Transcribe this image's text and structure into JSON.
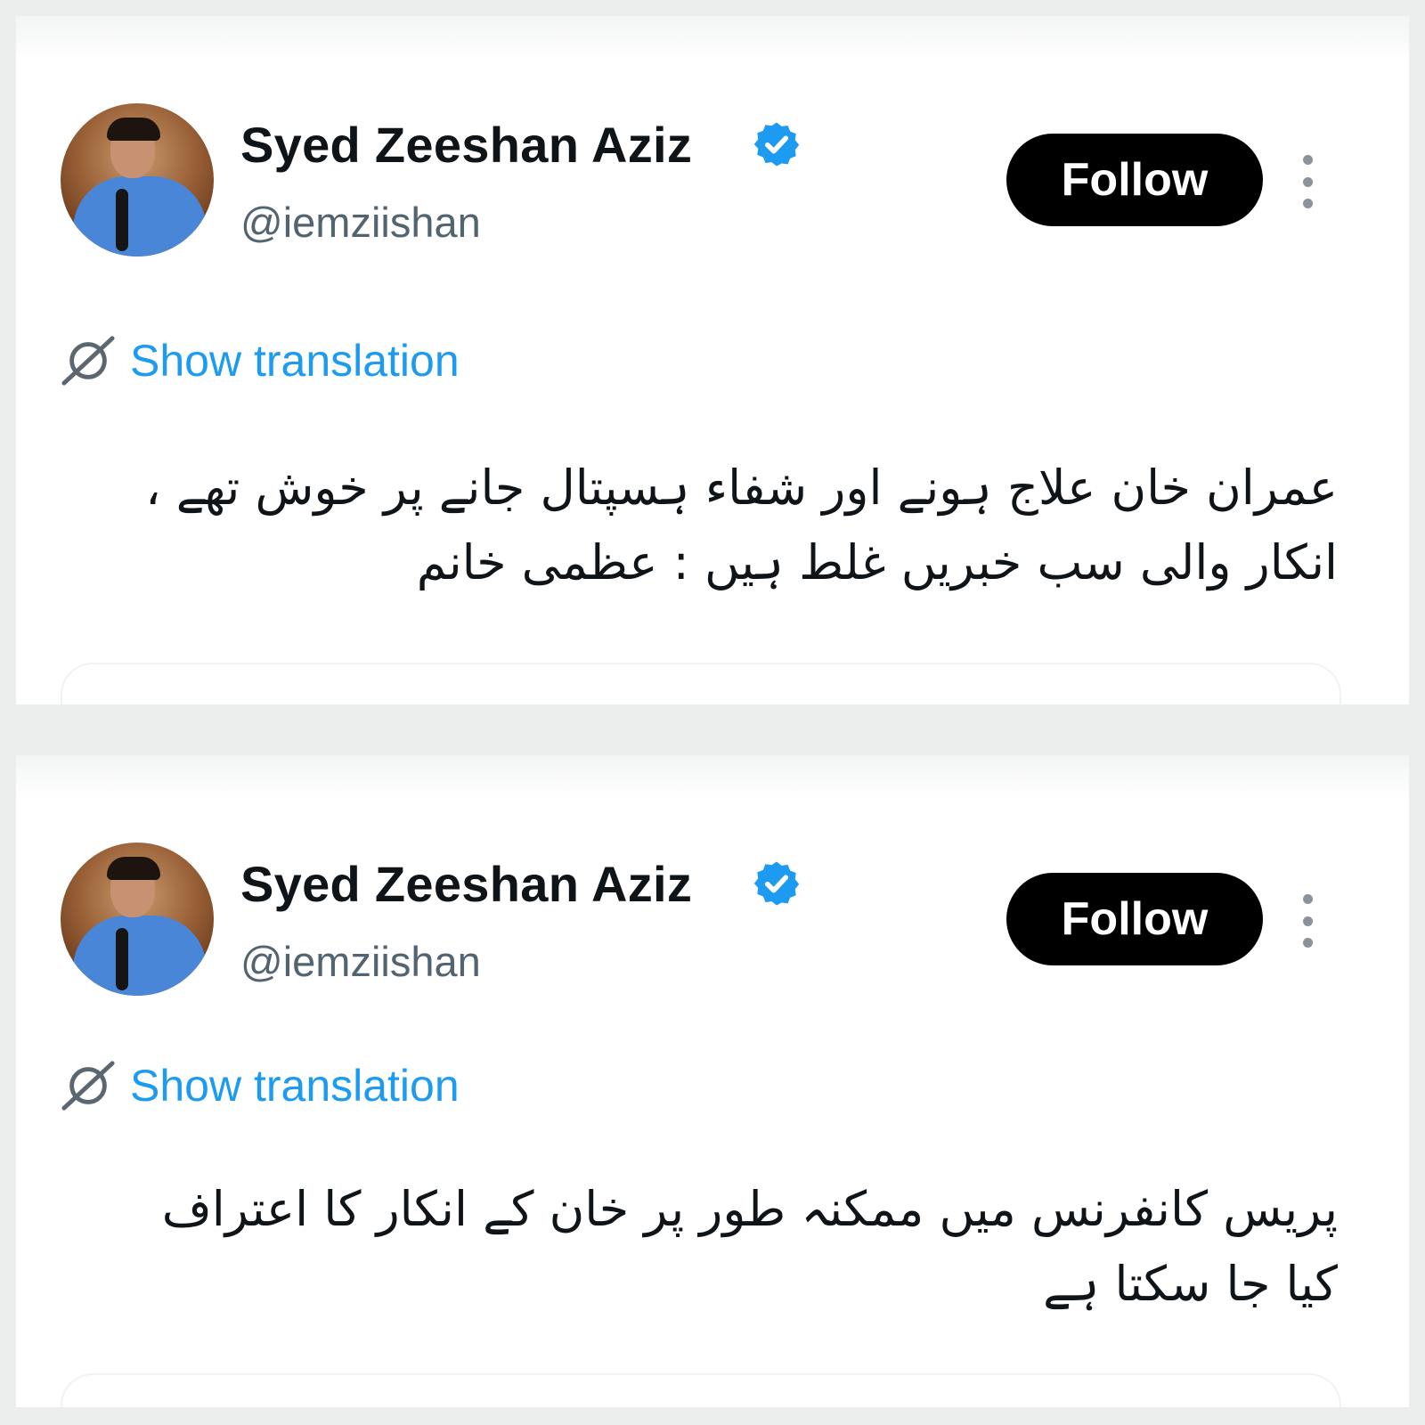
{
  "tweets": [
    {
      "author_name": "Syed Zeeshan Aziz",
      "handle": "@iemziishan",
      "follow_label": "Follow",
      "translation_label": "Show translation",
      "text": "عمران خان علاج ہونے اور شفاء ہسپتال جانے پر خوش تھے ، انکار والی سب خبریں غلط ہیں : عظمی خانم"
    },
    {
      "author_name": "Syed Zeeshan Aziz",
      "handle": "@iemziishan",
      "follow_label": "Follow",
      "translation_label": "Show translation",
      "text": "پریس کانفرنس میں ممکنہ طور پر خان کے انکار کا اعتراف کیا جا سکتا ہے"
    }
  ],
  "icons": {
    "verified": "verified-badge-icon",
    "more": "more-options-icon",
    "translate": "translate-globe-icon"
  },
  "colors": {
    "accent": "#1d9bf0",
    "button_bg": "#000000",
    "handle_gray": "#536471",
    "text": "#0f1419"
  }
}
